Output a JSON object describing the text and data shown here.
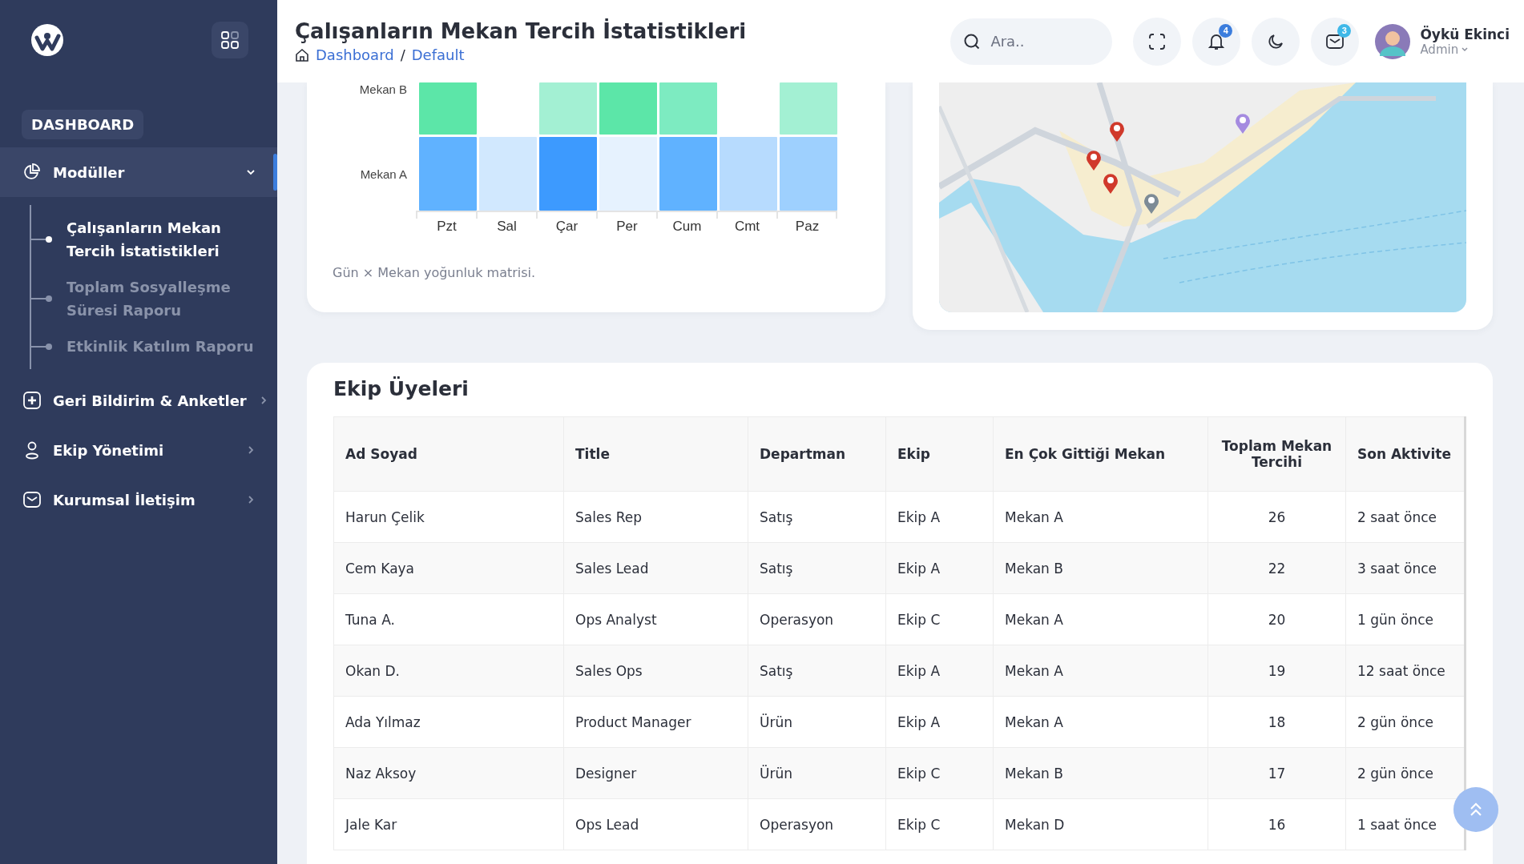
{
  "sidebar": {
    "section_label": "DASHBOARD",
    "items": [
      {
        "label": "Modüller",
        "kind": "pie",
        "expanded": true,
        "selected": true,
        "children": [
          {
            "label": "Çalışanların Mekan Tercih İstatistikleri",
            "selected": true
          },
          {
            "label": "Toplam Sosyalleşme Süresi Raporu",
            "selected": false
          },
          {
            "label": "Etkinlik Katılım Raporu",
            "selected": false
          }
        ]
      },
      {
        "label": "Geri Bildirim & Anketler",
        "kind": "plus",
        "expanded": false,
        "selected": false
      },
      {
        "label": "Ekip Yönetimi",
        "kind": "user",
        "expanded": false,
        "selected": false
      },
      {
        "label": "Kurumsal İletişim",
        "kind": "mail",
        "expanded": false,
        "selected": false
      }
    ]
  },
  "header": {
    "title": "Çalışanların Mekan Tercih İstatistikleri",
    "breadcrumb": [
      "Dashboard",
      "Default"
    ],
    "breadcrumb_separator": "/",
    "search": {
      "placeholder": "Ara.."
    },
    "notifications": {
      "badge": "4",
      "color": "#3b7ddd"
    },
    "messages": {
      "badge": "3",
      "color": "#3fb8e8"
    },
    "user": {
      "name": "Öykü Ekinci",
      "role": "Admin"
    }
  },
  "heatmap": {
    "rows": [
      {
        "label": "Mekan B",
        "cells": [
          {
            "color": "#5ce6a8"
          },
          null,
          {
            "color": "#a3f0d3"
          },
          {
            "color": "#5ce6a8"
          },
          {
            "color": "#7debc1"
          },
          null,
          {
            "color": "#a3f0d3"
          }
        ]
      },
      {
        "label": "Mekan A",
        "cells": [
          {
            "color": "#60b2ff"
          },
          {
            "color": "#d1e8fe"
          },
          {
            "color": "#3d9afe"
          },
          {
            "color": "#e6f2fe"
          },
          {
            "color": "#60b2ff"
          },
          {
            "color": "#b7dbfe"
          },
          {
            "color": "#9ed0fe"
          }
        ]
      }
    ],
    "days": [
      "Pzt",
      "Sal",
      "Çar",
      "Per",
      "Cum",
      "Cmt",
      "Paz"
    ],
    "caption": "Gün × Mekan yoğunluk matrisi."
  },
  "members": {
    "title": "Ekip Üyeleri",
    "columns": [
      "Ad Soyad",
      "Title",
      "Departman",
      "Ekip",
      "En Çok Gittiği Mekan",
      "Toplam Mekan Tercihi",
      "Son Aktivite"
    ],
    "rows": [
      [
        "Harun Çelik",
        "Sales Rep",
        "Satış",
        "Ekip A",
        "Mekan A",
        "26",
        "2 saat önce"
      ],
      [
        "Cem Kaya",
        "Sales Lead",
        "Satış",
        "Ekip A",
        "Mekan B",
        "22",
        "3 saat önce"
      ],
      [
        "Tuna A.",
        "Ops Analyst",
        "Operasyon",
        "Ekip C",
        "Mekan A",
        "20",
        "1 gün önce"
      ],
      [
        "Okan D.",
        "Sales Ops",
        "Satış",
        "Ekip A",
        "Mekan A",
        "19",
        "12 saat önce"
      ],
      [
        "Ada Yılmaz",
        "Product Manager",
        "Ürün",
        "Ekip A",
        "Mekan A",
        "18",
        "2 gün önce"
      ],
      [
        "Naz Aksoy",
        "Designer",
        "Ürün",
        "Ekip C",
        "Mekan B",
        "17",
        "2 gün önce"
      ],
      [
        "Jale Kar",
        "Ops Lead",
        "Operasyon",
        "Ekip C",
        "Mekan D",
        "16",
        "1 saat önce"
      ]
    ]
  }
}
